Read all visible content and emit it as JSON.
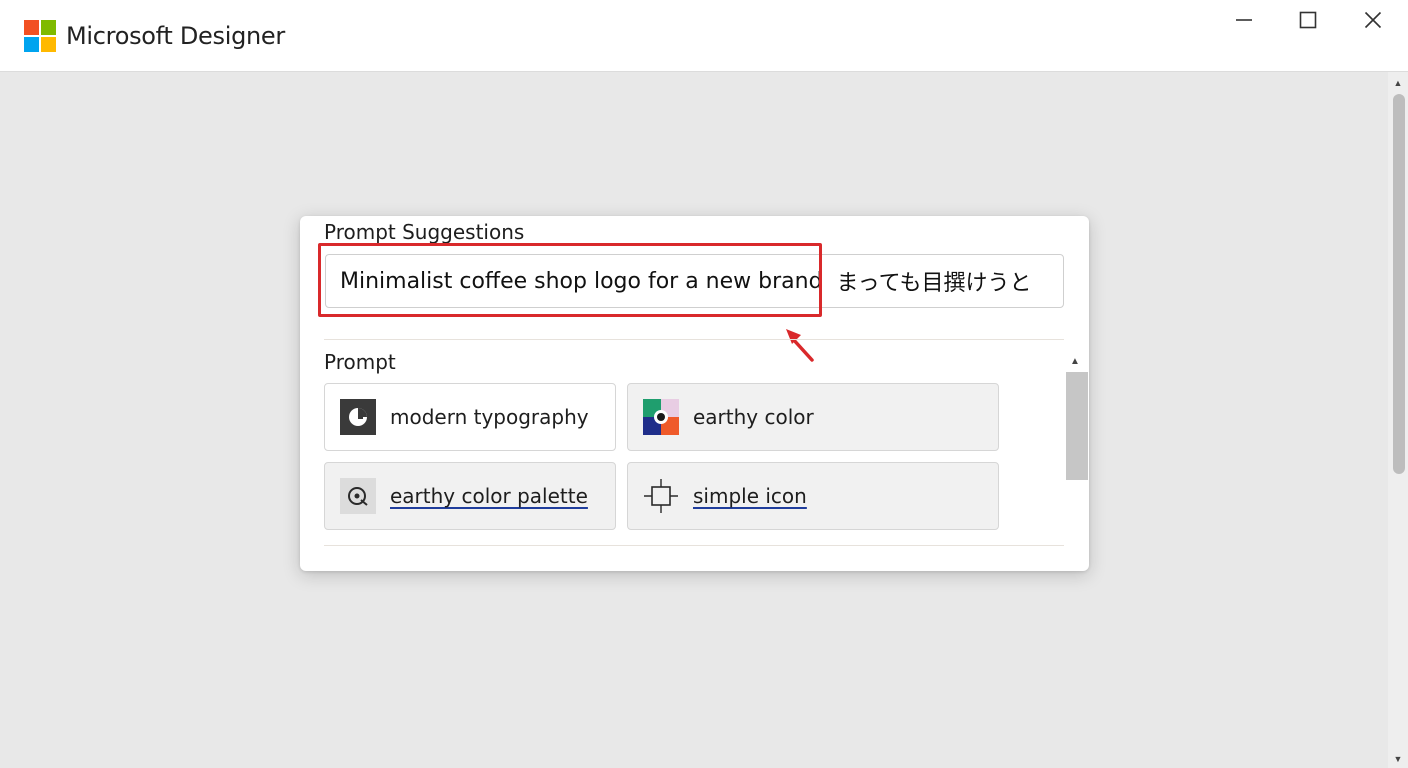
{
  "app": {
    "title": "Microsoft Designer",
    "logo_colors": [
      "#f25022",
      "#7fba00",
      "#00a4ef",
      "#ffb900"
    ]
  },
  "window_controls": {
    "minimize_icon": "minimize-icon",
    "maximize_icon": "maximize-icon",
    "close_icon": "close-icon"
  },
  "suggestions": {
    "heading": "Prompt Suggestions",
    "input_value": "Minimalist coffee shop logo for a new brand",
    "input_trailing_text": "まっても目撰けうと",
    "highlight_color": "#d9292b"
  },
  "prompt": {
    "heading": "Prompt",
    "chips": [
      {
        "label": "modern typography",
        "icon": "typography-icon",
        "link": false
      },
      {
        "label": "earthy color",
        "icon": "color-swatch-icon",
        "link": false
      },
      {
        "label": "earthy color palette",
        "icon": "palette-icon",
        "link": true
      },
      {
        "label": "simple icon",
        "icon": "frame-icon",
        "link": true
      }
    ]
  }
}
